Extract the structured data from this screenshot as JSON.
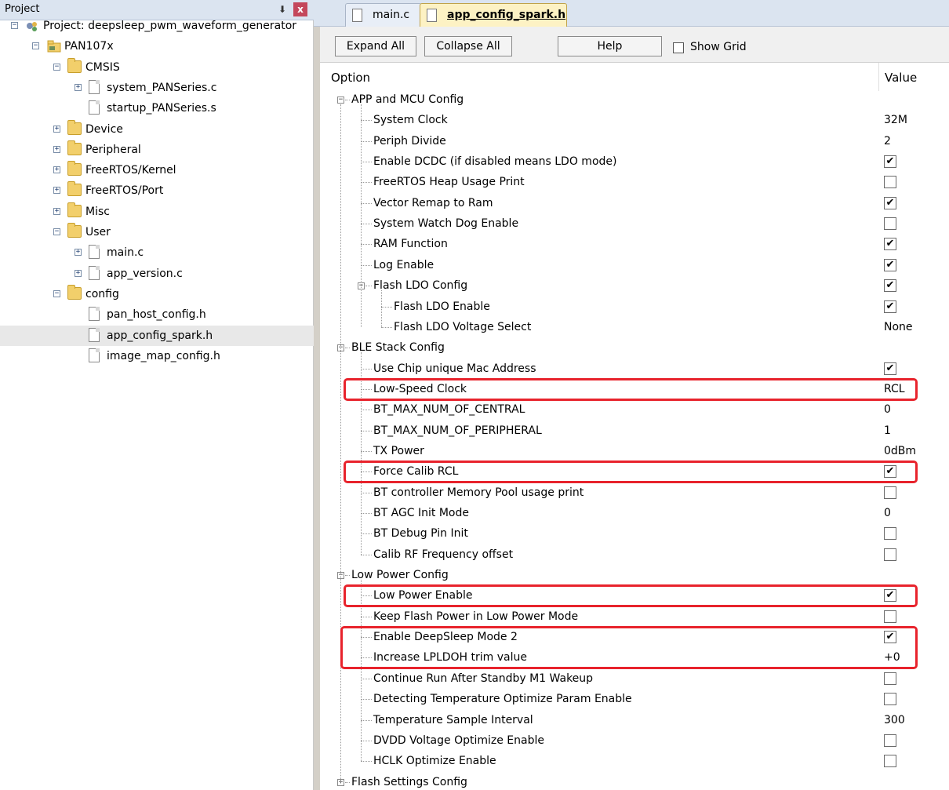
{
  "project_panel": {
    "title": "Project",
    "pin_glyph": "ℂ",
    "close_glyph": "x",
    "tree": [
      {
        "label": "Project: deepsleep_pwm_waveform_generator",
        "type": "project-root",
        "expander": "-"
      },
      {
        "label": "PAN107x",
        "type": "target",
        "expander": "-"
      },
      {
        "label": "CMSIS",
        "type": "folder",
        "expander": "-"
      },
      {
        "label": "system_PANSeries.c",
        "type": "file",
        "expander": "+"
      },
      {
        "label": "startup_PANSeries.s",
        "type": "file",
        "expander": ""
      },
      {
        "label": "Device",
        "type": "folder",
        "expander": "+"
      },
      {
        "label": "Peripheral",
        "type": "folder",
        "expander": "+"
      },
      {
        "label": "FreeRTOS/Kernel",
        "type": "folder",
        "expander": "+"
      },
      {
        "label": "FreeRTOS/Port",
        "type": "folder",
        "expander": "+"
      },
      {
        "label": "Misc",
        "type": "folder",
        "expander": "+"
      },
      {
        "label": "User",
        "type": "folder",
        "expander": "-"
      },
      {
        "label": "main.c",
        "type": "file",
        "expander": "+"
      },
      {
        "label": "app_version.c",
        "type": "file",
        "expander": "+"
      },
      {
        "label": "config",
        "type": "folder",
        "expander": "-"
      },
      {
        "label": "pan_host_config.h",
        "type": "file",
        "expander": ""
      },
      {
        "label": "app_config_spark.h",
        "type": "file",
        "expander": "",
        "selected": true
      },
      {
        "label": "image_map_config.h",
        "type": "file",
        "expander": ""
      }
    ]
  },
  "tabs": [
    {
      "label": "main.c",
      "active": false
    },
    {
      "label": "app_config_spark.h",
      "active": true
    }
  ],
  "toolbar": {
    "expand_all": "Expand All",
    "collapse_all": "Collapse All",
    "help": "Help",
    "show_grid_label": "Show Grid",
    "show_grid_checked": false
  },
  "grid": {
    "col_option": "Option",
    "col_value": "Value",
    "rows": [
      {
        "label": "APP and MCU Config",
        "level": 0,
        "group": true,
        "expander": "-"
      },
      {
        "label": "System Clock",
        "level": 1,
        "value": "32M"
      },
      {
        "label": "Periph Divide",
        "level": 1,
        "value": "2"
      },
      {
        "label": "Enable DCDC (if disabled means LDO mode)",
        "level": 1,
        "checked": true
      },
      {
        "label": "FreeRTOS Heap Usage Print",
        "level": 1,
        "checked": false
      },
      {
        "label": "Vector Remap to Ram",
        "level": 1,
        "checked": true
      },
      {
        "label": "System Watch Dog Enable",
        "level": 1,
        "checked": false
      },
      {
        "label": "RAM Function",
        "level": 1,
        "checked": true
      },
      {
        "label": "Log Enable",
        "level": 1,
        "checked": true
      },
      {
        "label": "Flash LDO Config",
        "level": 1,
        "group": true,
        "expander": "-",
        "checked": true
      },
      {
        "label": "Flash LDO Enable",
        "level": 2,
        "checked": true
      },
      {
        "label": "Flash LDO Voltage Select",
        "level": 2,
        "value": "None"
      },
      {
        "label": "BLE Stack Config",
        "level": 0,
        "group": true,
        "expander": "-"
      },
      {
        "label": "Use Chip unique Mac Address",
        "level": 1,
        "checked": true
      },
      {
        "label": "Low-Speed Clock",
        "level": 1,
        "value": "RCL",
        "highlight": true
      },
      {
        "label": "BT_MAX_NUM_OF_CENTRAL",
        "level": 1,
        "value": "0"
      },
      {
        "label": "BT_MAX_NUM_OF_PERIPHERAL",
        "level": 1,
        "value": "1"
      },
      {
        "label": "TX Power",
        "level": 1,
        "value": "0dBm"
      },
      {
        "label": "Force Calib RCL",
        "level": 1,
        "checked": true,
        "highlight": true
      },
      {
        "label": "BT controller Memory Pool usage print",
        "level": 1,
        "checked": false
      },
      {
        "label": "BT AGC Init Mode",
        "level": 1,
        "value": "0"
      },
      {
        "label": "BT Debug Pin Init",
        "level": 1,
        "checked": false
      },
      {
        "label": "Calib RF Frequency offset",
        "level": 1,
        "checked": false
      },
      {
        "label": "Low Power Config",
        "level": 0,
        "group": true,
        "expander": "-"
      },
      {
        "label": "Low Power Enable",
        "level": 1,
        "checked": true,
        "highlight": true
      },
      {
        "label": "Keep Flash Power in Low Power Mode",
        "level": 1,
        "checked": false
      },
      {
        "label": "Enable DeepSleep Mode 2",
        "level": 1,
        "checked": true,
        "highlight_group": "a"
      },
      {
        "label": "Increase LPLDOH trim value",
        "level": 1,
        "value": "+0",
        "highlight_group": "a"
      },
      {
        "label": "Continue Run After Standby M1 Wakeup",
        "level": 1,
        "checked": false
      },
      {
        "label": "Detecting Temperature Optimize Param Enable",
        "level": 1,
        "checked": false
      },
      {
        "label": "Temperature Sample Interval",
        "level": 1,
        "value": "300"
      },
      {
        "label": "DVDD Voltage Optimize Enable",
        "level": 1,
        "checked": false
      },
      {
        "label": "HCLK Optimize Enable",
        "level": 1,
        "checked": false
      },
      {
        "label": "Flash Settings Config",
        "level": 0,
        "group": true,
        "expander": "+"
      }
    ]
  },
  "colors": {
    "highlight": "#e8232c",
    "active_tab": "#fdf2c4",
    "panel_header": "#dbe4f0"
  }
}
